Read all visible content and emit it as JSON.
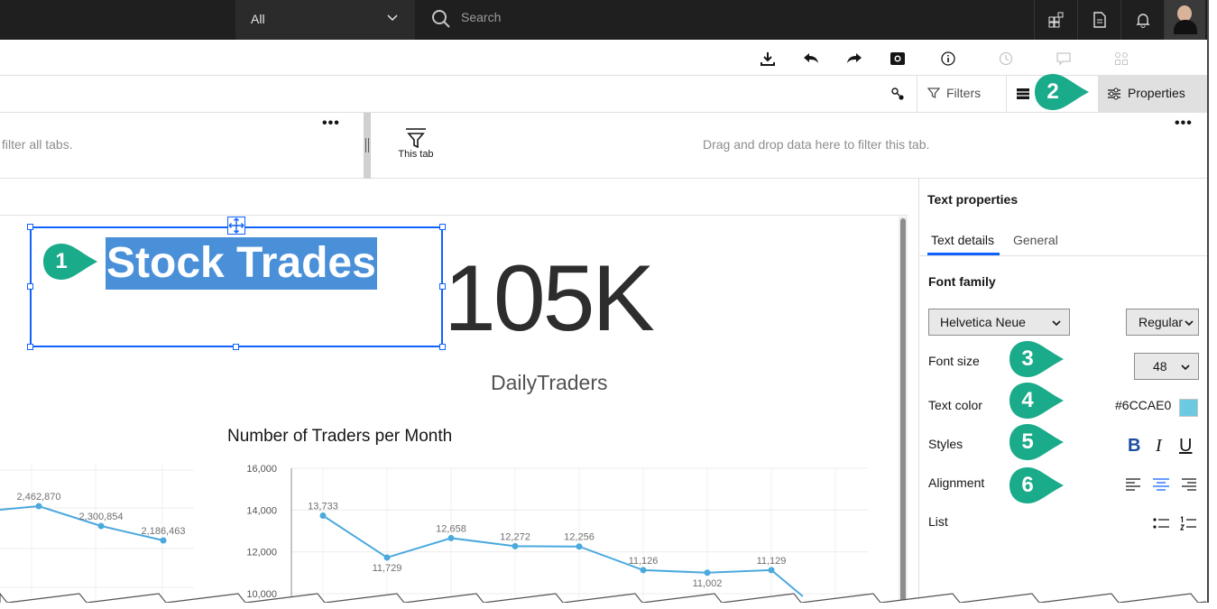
{
  "topbar": {
    "scope_selected": "All",
    "search_placeholder": "Search"
  },
  "toolbar": {
    "filters_label": "Filters",
    "properties_label": "Properties"
  },
  "filter_area": {
    "all_tabs_text": "filter all tabs.",
    "this_tab_label": "This tab",
    "drop_message": "Drag and drop data here to filter this tab.",
    "more_label": "•••"
  },
  "canvas": {
    "title_widget_text": "Stock Trades",
    "kpi_value": "105K",
    "kpi_label": "DailyTraders"
  },
  "chart_data": [
    {
      "type": "line",
      "title": "",
      "points": [
        {
          "label": "2,462,870"
        },
        {
          "label": "2,300,854"
        },
        {
          "label": "2,186,463"
        }
      ],
      "values": [
        2462870,
        2300854,
        2186463
      ]
    },
    {
      "type": "line",
      "title": "Number of Traders per Month",
      "y_ticks": [
        "16,000",
        "14,000",
        "12,000",
        "10,000"
      ],
      "ylim": [
        10000,
        16000
      ],
      "values": [
        13733,
        11729,
        12658,
        12272,
        12256,
        11126,
        11002,
        11129
      ],
      "labels": [
        "13,733",
        "11,729",
        "12,658",
        "12,272",
        "12,256",
        "11,126",
        "11,002",
        "11,129"
      ],
      "color": "#4aa9dd"
    }
  ],
  "panel": {
    "title": "Text properties",
    "tabs": [
      {
        "label": "Text details",
        "active": true
      },
      {
        "label": "General",
        "active": false
      }
    ],
    "section_font_family": "Font family",
    "font_family_value": "Helvetica Neue",
    "font_weight_value": "Regular",
    "font_size_label": "Font size",
    "font_size_value": "48",
    "text_color_label": "Text color",
    "text_color_value": "#6CCAE0",
    "styles_label": "Styles",
    "style_buttons": [
      "B",
      "I",
      "U"
    ],
    "alignment_label": "Alignment",
    "list_label": "List"
  },
  "callouts": [
    "1",
    "2",
    "3",
    "4",
    "5",
    "6"
  ],
  "colors": {
    "accent": "#0f62fe",
    "callout": "#1aab8a",
    "selection": "#4a90d9",
    "swatch": "#6CCAE0"
  }
}
